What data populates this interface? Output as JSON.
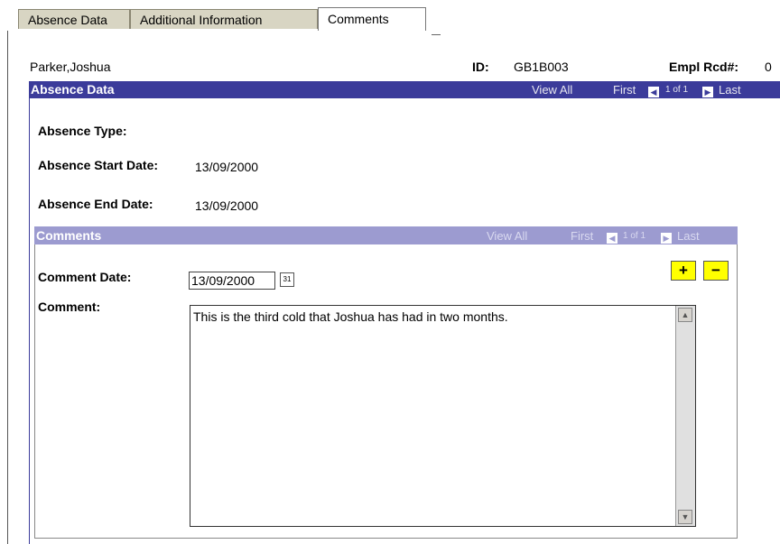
{
  "tabs": [
    {
      "label": "Absence Data"
    },
    {
      "label": "Additional Information"
    },
    {
      "label": "Comments"
    }
  ],
  "header": {
    "employee_name": "Parker,Joshua",
    "id_label": "ID:",
    "id_value": "GB1B003",
    "empl_rcd_label": "Empl Rcd#:",
    "empl_rcd_value": "0"
  },
  "absence_section": {
    "title": "Absence Data",
    "view_all": "View All",
    "first": "First",
    "count": "1 of 1",
    "last": "Last",
    "type_label": "Absence Type:",
    "type_value": "",
    "start_label": "Absence Start Date:",
    "start_value": "13/09/2000",
    "end_label": "Absence End Date:",
    "end_value": "13/09/2000"
  },
  "comments_section": {
    "title": "Comments",
    "view_all": "View All",
    "first": "First",
    "count": "1 of 1",
    "last": "Last",
    "date_label": "Comment Date:",
    "date_value": "13/09/2000",
    "comment_label": "Comment:",
    "comment_value": "This is the third cold that Joshua has had in two months.",
    "add_label": "+",
    "remove_label": "−"
  },
  "colors": {
    "primary_bar": "#3b3b9a",
    "secondary_bar": "#9c9bd0",
    "add_remove": "#ffff00",
    "tab_inactive": "#d8d5c3"
  }
}
